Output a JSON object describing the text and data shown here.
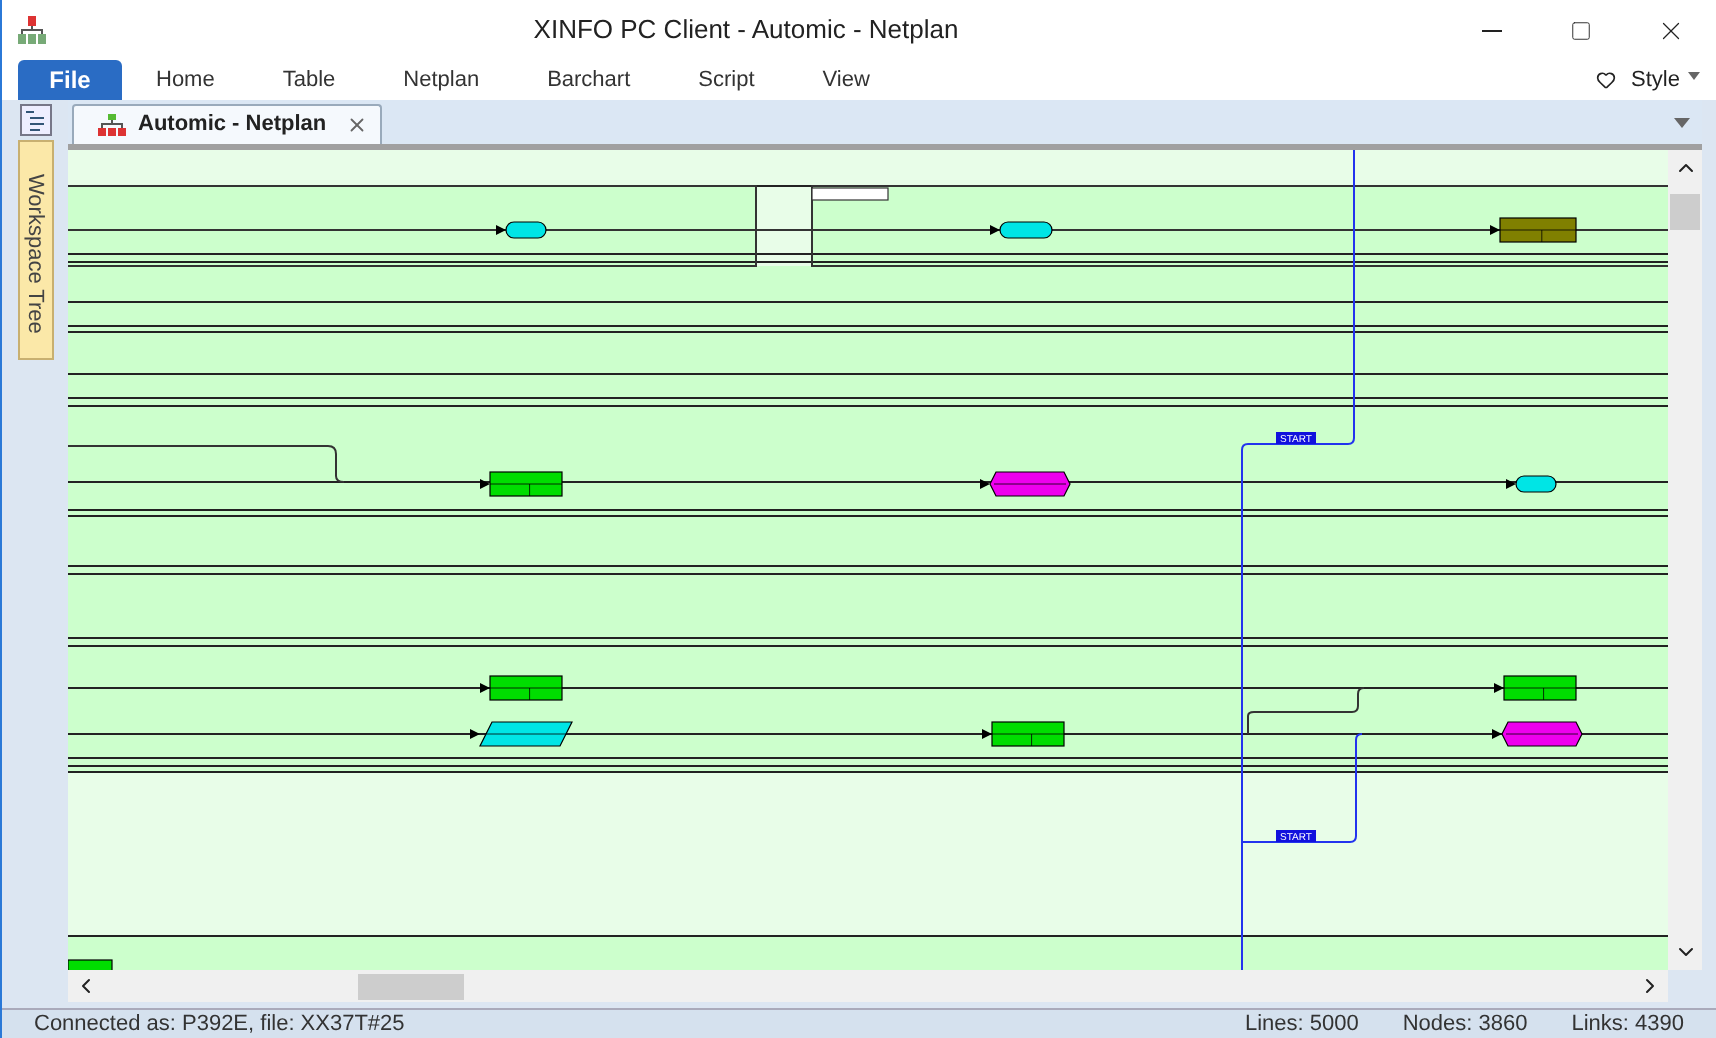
{
  "window": {
    "title": "XINFO PC Client - Automic - Netplan"
  },
  "menu": [
    {
      "label": "File",
      "selected": true
    },
    {
      "label": "Home",
      "selected": false
    },
    {
      "label": "Table",
      "selected": false
    },
    {
      "label": "Netplan",
      "selected": false
    },
    {
      "label": "Barchart",
      "selected": false
    },
    {
      "label": "Script",
      "selected": false
    },
    {
      "label": "View",
      "selected": false
    }
  ],
  "style_menu": {
    "label": "Style"
  },
  "tabs": [
    {
      "label": "Automic - Netplan",
      "selected": true
    }
  ],
  "sidebar": {
    "label": "Workspace Tree"
  },
  "netplan": {
    "nodes": [
      {
        "kind": "pill",
        "color": "#00e5e5"
      },
      {
        "kind": "pill",
        "color": "#00e5e5"
      },
      {
        "kind": "box",
        "color": "#808000"
      },
      {
        "kind": "box",
        "color": "#00dd00"
      },
      {
        "kind": "hexagon",
        "color": "#ee00ee"
      },
      {
        "kind": "pill",
        "color": "#00e5e5"
      },
      {
        "kind": "box",
        "color": "#00dd00"
      },
      {
        "kind": "box",
        "color": "#00dd00"
      },
      {
        "kind": "parallelogram",
        "color": "#00e5e5"
      },
      {
        "kind": "box",
        "color": "#00dd00"
      },
      {
        "kind": "hexagon",
        "color": "#ee00ee"
      },
      {
        "kind": "box",
        "color": "#00dd00"
      }
    ],
    "labels": [
      {
        "text": "START"
      },
      {
        "text": "START"
      }
    ]
  },
  "status_bar": {
    "connection": "Connected as: P392E, file: XX37T#25",
    "lines": "Lines: 5000",
    "nodes": "Nodes: 3860",
    "links": "Links: 4390"
  }
}
